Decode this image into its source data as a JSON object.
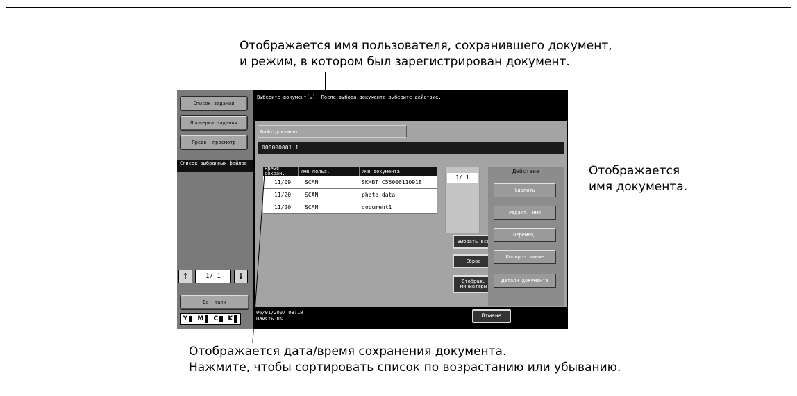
{
  "callouts": {
    "top_line1": "Отображается имя пользователя, сохранившего документ,",
    "top_line2": "и режим, в котором был зарегистрирован документ.",
    "right_line1": "Отображается",
    "right_line2": "имя документа.",
    "bottom_line1": "Отображается дата/время сохранения документа.",
    "bottom_line2": "Нажмите, чтобы сортировать список по возрастанию или убыванию."
  },
  "sidebar": {
    "buttons": [
      "Список заданий",
      "Проверка задания",
      "Предв. просмотр"
    ],
    "section_label": "Список выбранных файлов",
    "pager_value": "1/ 1",
    "details_label": "Де- тали",
    "toner": [
      "Y",
      "M",
      "C",
      "K"
    ]
  },
  "message": "Выберите документ(ы). После выбора документа выберите действие.",
  "panel": {
    "title": "Файл-документ",
    "path": "000000001  1"
  },
  "table": {
    "headers": [
      "Время сохран.",
      "Имя польз.",
      "Имя документа"
    ],
    "rows": [
      {
        "time": "11/09",
        "user": "SCAN",
        "name": "SKMBT_C55006110918"
      },
      {
        "time": "11/20",
        "user": "SCAN",
        "name": "photo data"
      },
      {
        "time": "11/20",
        "user": "SCAN",
        "name": "document1"
      }
    ]
  },
  "page_indicator": "1/  1",
  "middle_buttons": [
    "Выбрать все",
    "Сброс",
    "Отображ. миниатюры"
  ],
  "actions": {
    "title": "Действие",
    "buttons": [
      "Удалить",
      "Редакт. имя",
      "Перемещ.",
      "Копиро- вание",
      "Детали документа"
    ]
  },
  "status": {
    "datetime": "06/01/2007   08:10",
    "memory": "Память          0%"
  },
  "cancel_label": "Отмена"
}
